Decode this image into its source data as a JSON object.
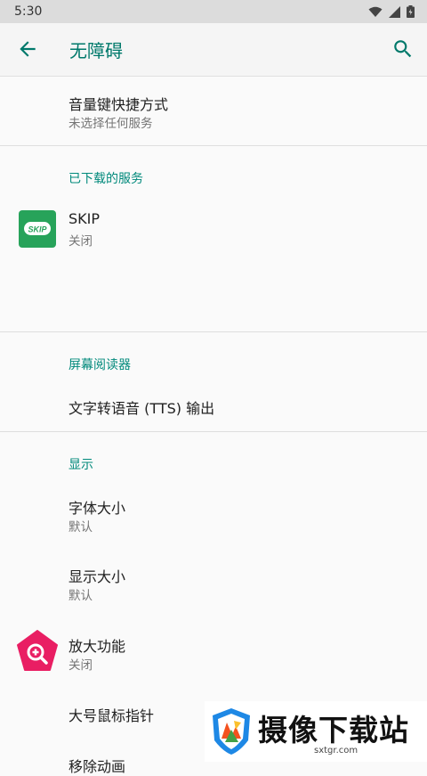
{
  "status": {
    "time": "5:30"
  },
  "appbar": {
    "title": "无障碍"
  },
  "items": {
    "volume_shortcut": {
      "title": "音量键快捷方式",
      "subtitle": "未选择任何服务"
    },
    "downloaded_section": "已下载的服务",
    "skip": {
      "title": "SKIP",
      "subtitle": "关闭",
      "logo_text": "SKIP"
    },
    "screen_reader_section": "屏幕阅读器",
    "tts": {
      "title": "文字转语音 (TTS) 输出"
    },
    "display_section": "显示",
    "font_size": {
      "title": "字体大小",
      "subtitle": "默认"
    },
    "display_size": {
      "title": "显示大小",
      "subtitle": "默认"
    },
    "magnification": {
      "title": "放大功能",
      "subtitle": "关闭"
    },
    "large_pointer": {
      "title": "大号鼠标指针"
    },
    "remove_animations": {
      "title": "移除动画"
    }
  },
  "watermark": {
    "brand": "摄像下载站",
    "url": "sxtgr.com"
  },
  "colors": {
    "accent": "#00897b",
    "skip_green": "#27a35a",
    "magnify_pink": "#e91e63"
  },
  "icons": {
    "back": "arrow-left-icon",
    "search": "search-icon",
    "skip": "skip-app-icon",
    "magnify": "magnification-icon",
    "wifi": "wifi-icon",
    "signal": "signal-icon",
    "battery": "battery-icon"
  }
}
